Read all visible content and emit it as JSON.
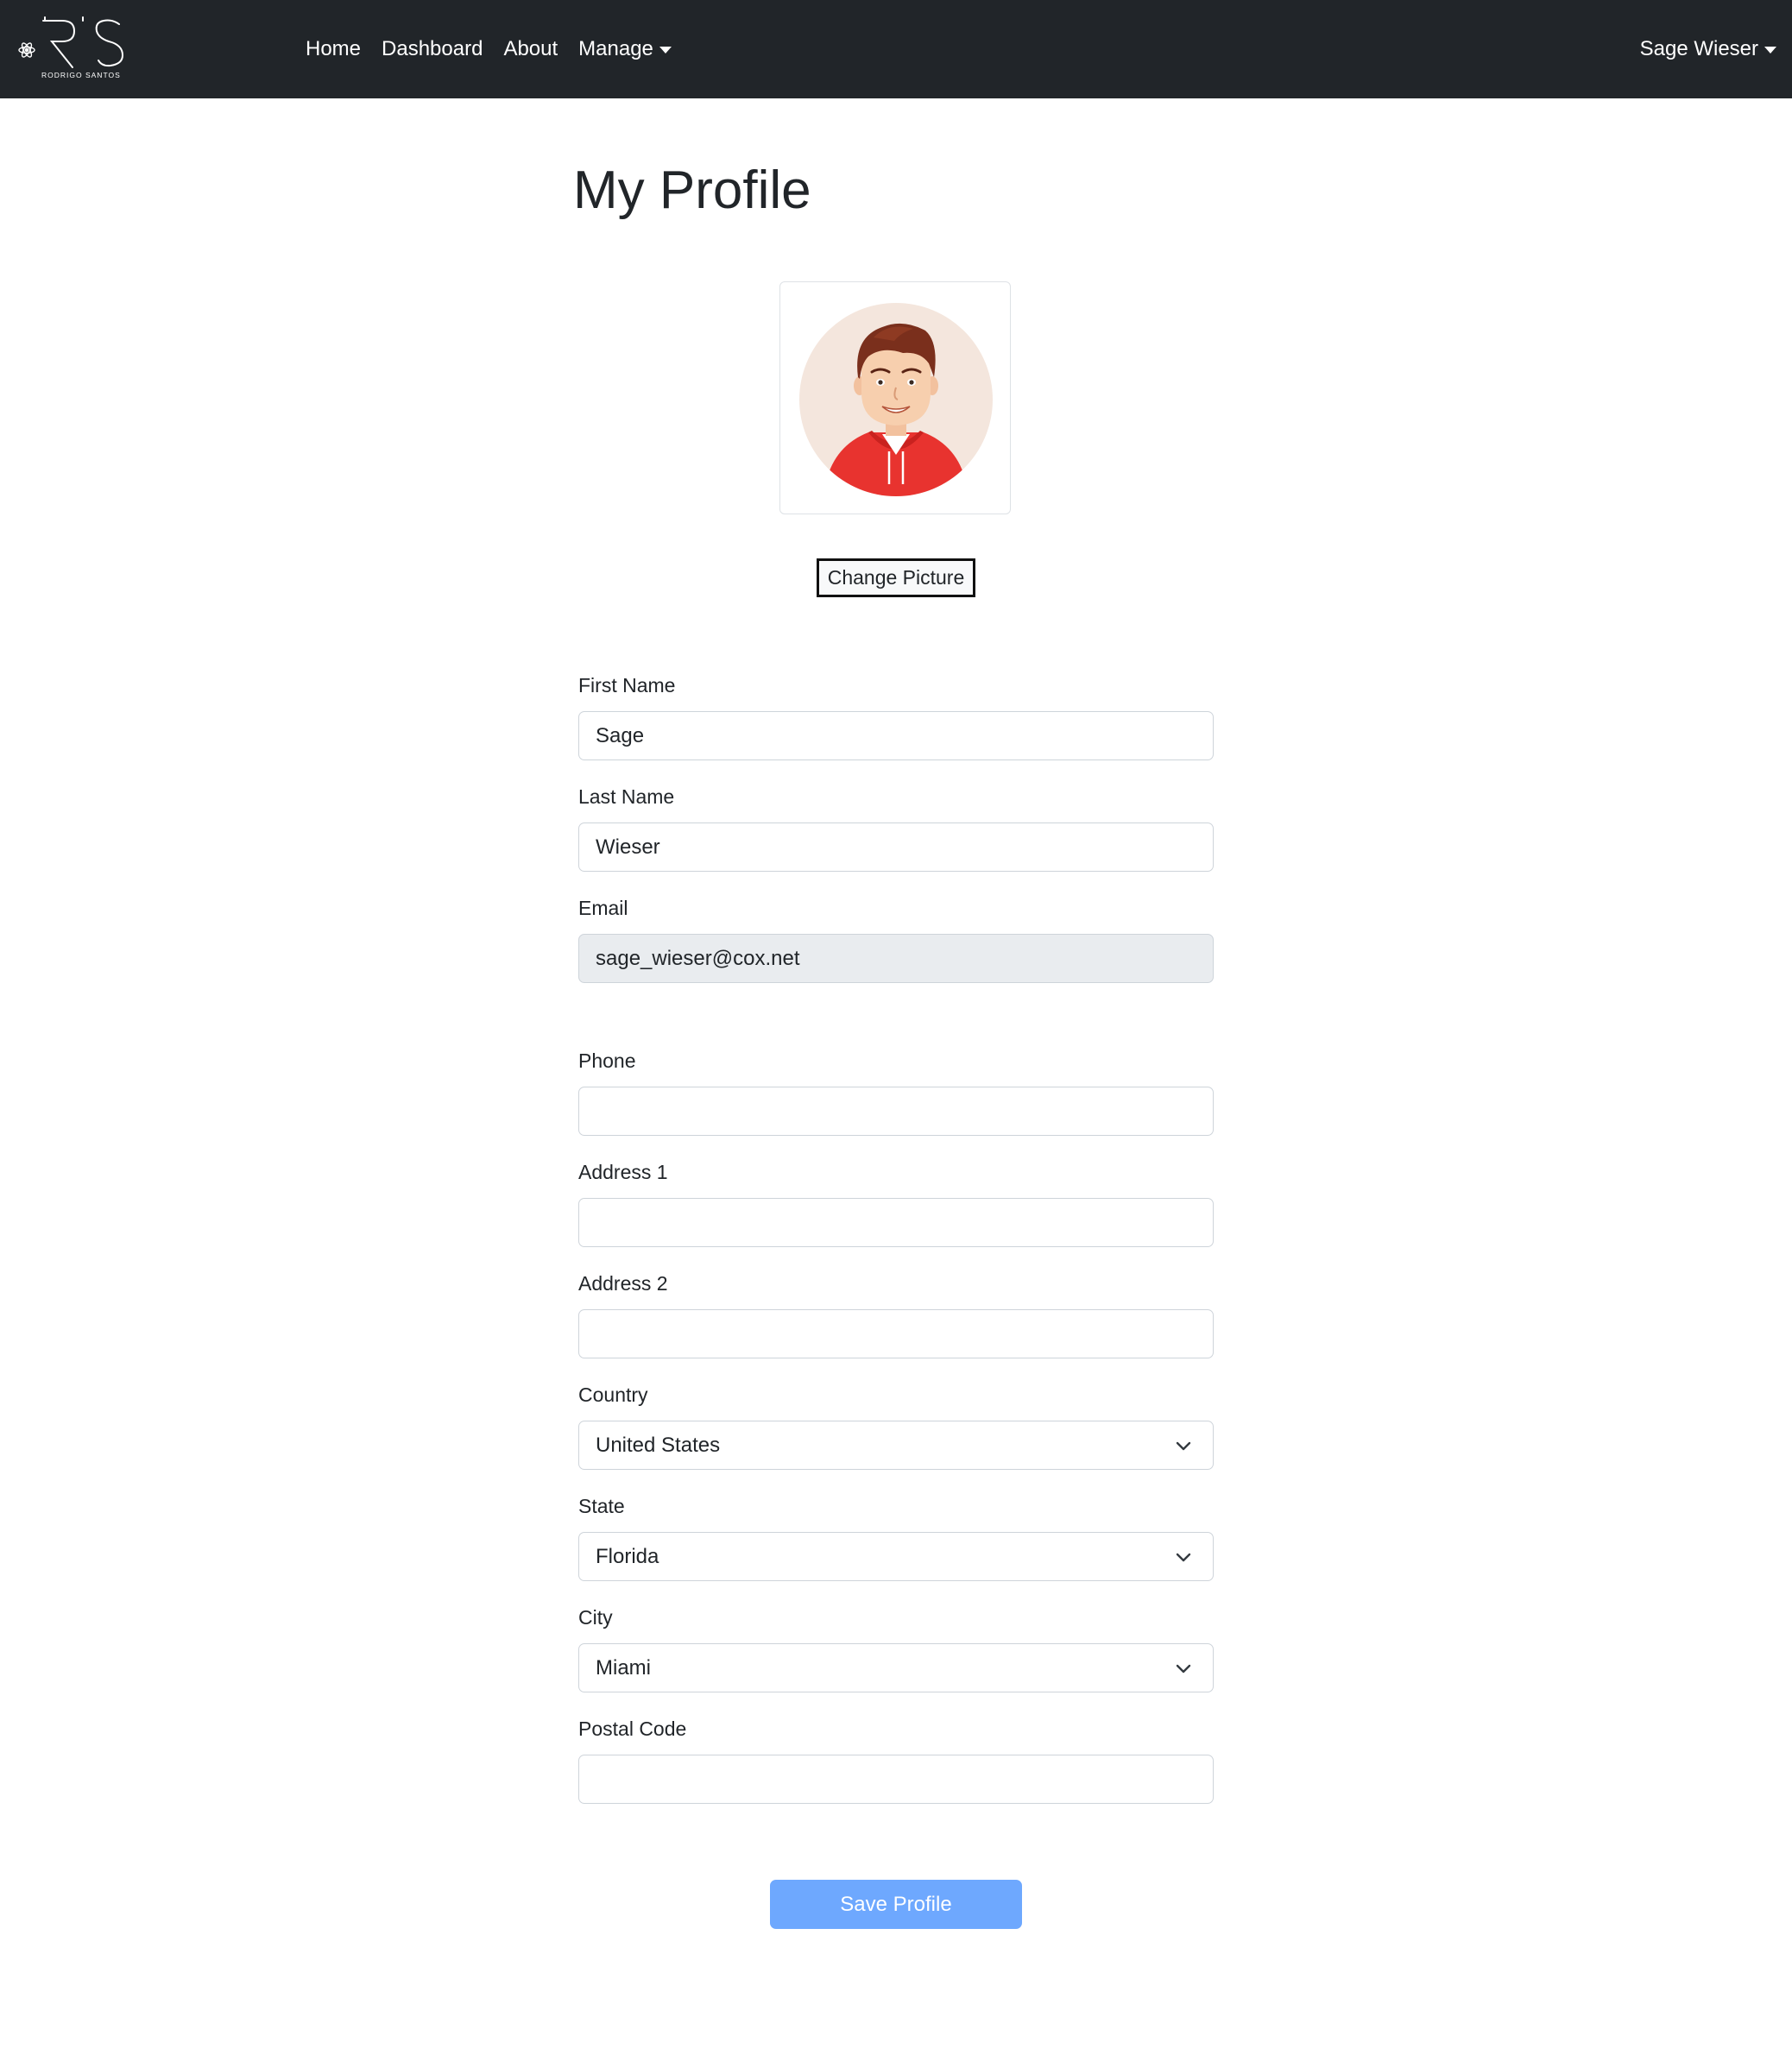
{
  "navbar": {
    "brand_text": "RODRIGO SANTOS",
    "links": [
      {
        "label": "Home"
      },
      {
        "label": "Dashboard"
      },
      {
        "label": "About"
      },
      {
        "label": "Manage"
      }
    ],
    "user_name": "Sage Wieser"
  },
  "page": {
    "title": "My Profile",
    "change_picture_label": "Change Picture",
    "save_label": "Save Profile"
  },
  "form": {
    "first_name": {
      "label": "First Name",
      "value": "Sage"
    },
    "last_name": {
      "label": "Last Name",
      "value": "Wieser"
    },
    "email": {
      "label": "Email",
      "value": "sage_wieser@cox.net"
    },
    "phone": {
      "label": "Phone",
      "value": ""
    },
    "address1": {
      "label": "Address 1",
      "value": ""
    },
    "address2": {
      "label": "Address 2",
      "value": ""
    },
    "country": {
      "label": "Country",
      "value": "United States"
    },
    "state": {
      "label": "State",
      "value": "Florida"
    },
    "city": {
      "label": "City",
      "value": "Miami"
    },
    "postal_code": {
      "label": "Postal Code",
      "value": ""
    }
  },
  "colors": {
    "navbar_bg": "#212529",
    "save_button": "#6ea8fe",
    "readonly_field": "#e9ecef"
  },
  "icons": [
    "atom-icon",
    "logo-icon",
    "caret-down-icon",
    "chevron-down-icon",
    "avatar-image"
  ]
}
